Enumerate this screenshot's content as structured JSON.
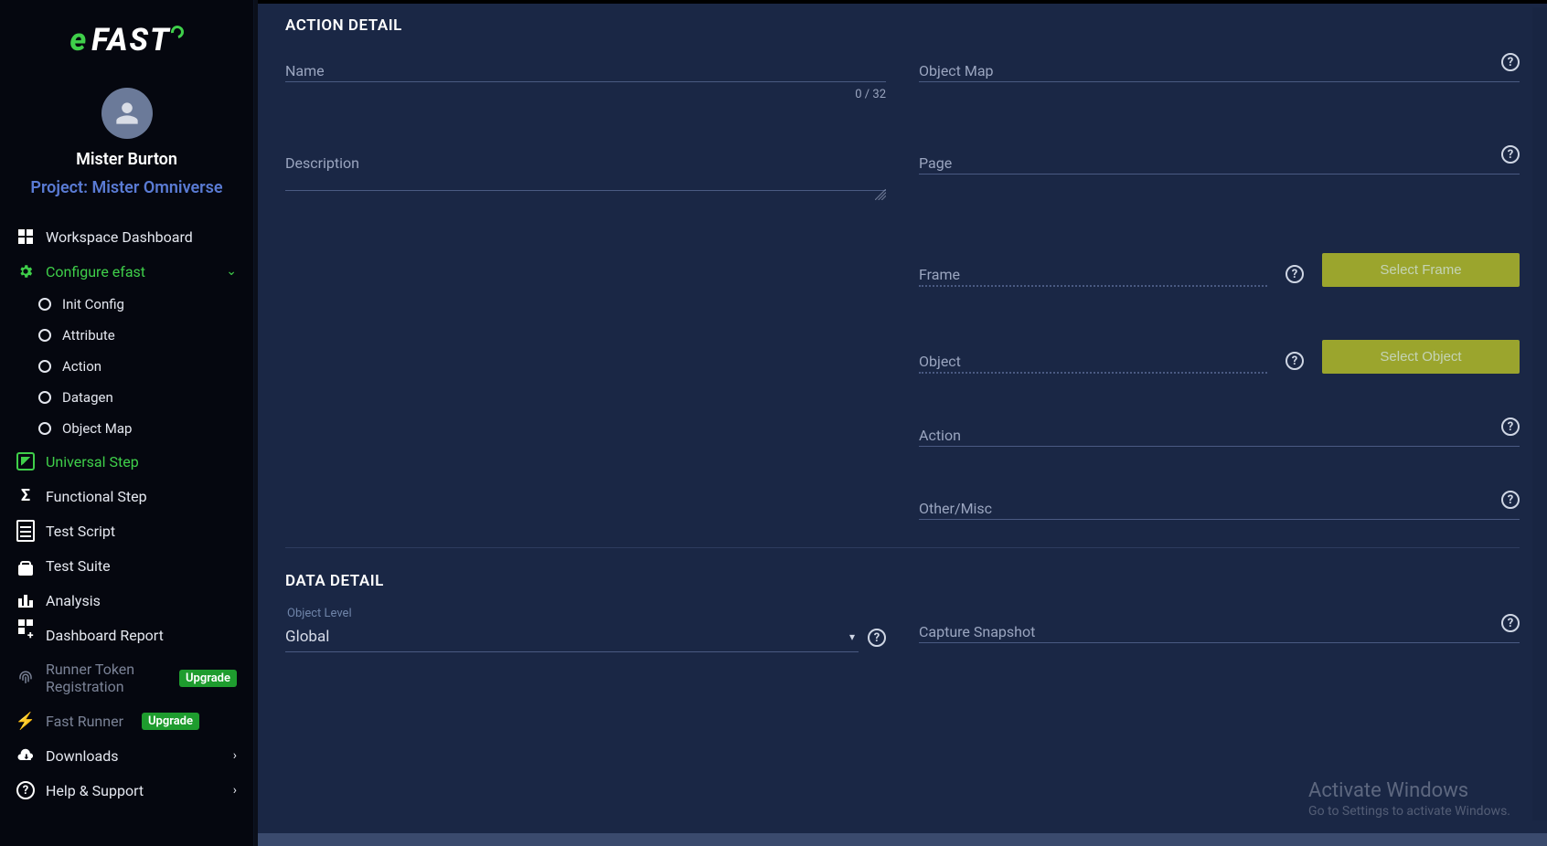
{
  "brand": {
    "full": "eFAST",
    "e": "e",
    "fast": "FAST"
  },
  "user": {
    "name": "Mister Burton",
    "project_prefix": "Project: ",
    "project_name": "Mister Omniverse"
  },
  "sidebar": {
    "dashboard": "Workspace Dashboard",
    "configure": "Configure efast",
    "subitems": {
      "init_config": "Init Config",
      "attribute": "Attribute",
      "action": "Action",
      "datagen": "Datagen",
      "object_map": "Object Map"
    },
    "universal_step": "Universal Step",
    "functional_step": "Functional Step",
    "test_script": "Test Script",
    "test_suite": "Test Suite",
    "analysis": "Analysis",
    "dashboard_report": "Dashboard Report",
    "runner_token": "Runner Token Registration",
    "fast_runner": "Fast Runner",
    "downloads": "Downloads",
    "help": "Help & Support",
    "upgrade": "Upgrade"
  },
  "main": {
    "action_detail_title": "ACTION DETAIL",
    "data_detail_title": "DATA DETAIL",
    "fields": {
      "name": "Name",
      "name_counter": "0 / 32",
      "description": "Description",
      "object_map": "Object Map",
      "page": "Page",
      "frame": "Frame",
      "object": "Object",
      "action": "Action",
      "other_misc": "Other/Misc",
      "object_level_label": "Object Level",
      "object_level_value": "Global",
      "capture_snapshot": "Capture Snapshot"
    },
    "buttons": {
      "select_frame": "Select Frame",
      "select_object": "Select Object"
    }
  },
  "watermark": {
    "line1": "Activate Windows",
    "line2": "Go to Settings to activate Windows."
  }
}
